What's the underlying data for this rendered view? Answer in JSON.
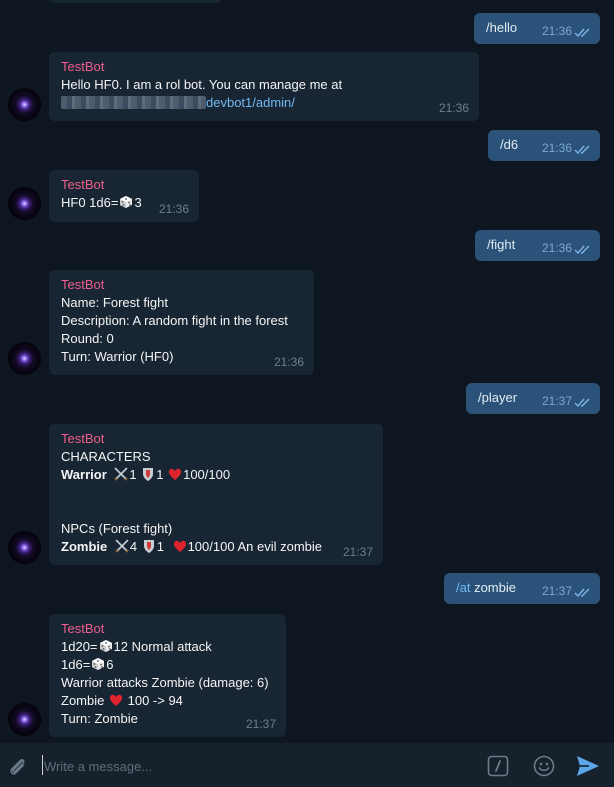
{
  "bot_name": "TestBot",
  "messages": [
    {
      "dir": "out",
      "text": "/hello",
      "time": "21:36"
    },
    {
      "dir": "in",
      "lines": [
        "Hello HF0. I am a rol bot. You can manage me at"
      ],
      "link_suffix": "devbot1/admin/",
      "time": "21:36"
    },
    {
      "dir": "out",
      "text": "/d6",
      "time": "21:36"
    },
    {
      "dir": "in",
      "lines": [
        "HF0 1d6=",
        "3"
      ],
      "time": "21:36"
    },
    {
      "dir": "out",
      "text": "/fight",
      "time": "21:36"
    },
    {
      "dir": "in",
      "lines": [
        "Name: Forest fight",
        "Description: A random fight in the forest",
        "Round: 0",
        "Turn: Warrior (HF0)"
      ],
      "time": "21:36"
    },
    {
      "dir": "out",
      "text": "/player",
      "time": "21:37"
    },
    {
      "dir": "in",
      "header": "CHARACTERS",
      "warrior": {
        "name": "Warrior",
        "atk": "1",
        "def": "1",
        "hp": "100/100"
      },
      "npcs_title": "NPCs (Forest fight)",
      "zombie": {
        "name": "Zombie",
        "atk": "4",
        "def": "1",
        "hp": "100/100 An evil zombie"
      },
      "time": "21:37"
    },
    {
      "dir": "out",
      "cmd": "/at",
      "text": " zombie",
      "time": "21:37"
    },
    {
      "dir": "in",
      "attack": {
        "roll1_prefix": "1d20=",
        "roll1": "12 Normal attack",
        "roll2_prefix": "1d6=",
        "roll2": "6",
        "result": "Warrior attacks Zombie (damage: 6)",
        "zombie_prefix": "Zombie",
        "zombie_hp": "100 -> 94",
        "turn": "Turn: Zombie"
      },
      "time": "21:37"
    }
  ],
  "composer": {
    "placeholder": "Write a message..."
  },
  "icons": [
    "attach-icon",
    "command-icon",
    "emoji-icon",
    "send-icon",
    "double-check-icon",
    "dice-icon",
    "sword-icon",
    "shield-icon",
    "heart-icon"
  ],
  "colors": {
    "background": "#0e1621",
    "incoming": "#182533",
    "outgoing": "#2b5278",
    "sender": "#ee5f8d",
    "link": "#71baf2",
    "composer": "#17212b"
  }
}
